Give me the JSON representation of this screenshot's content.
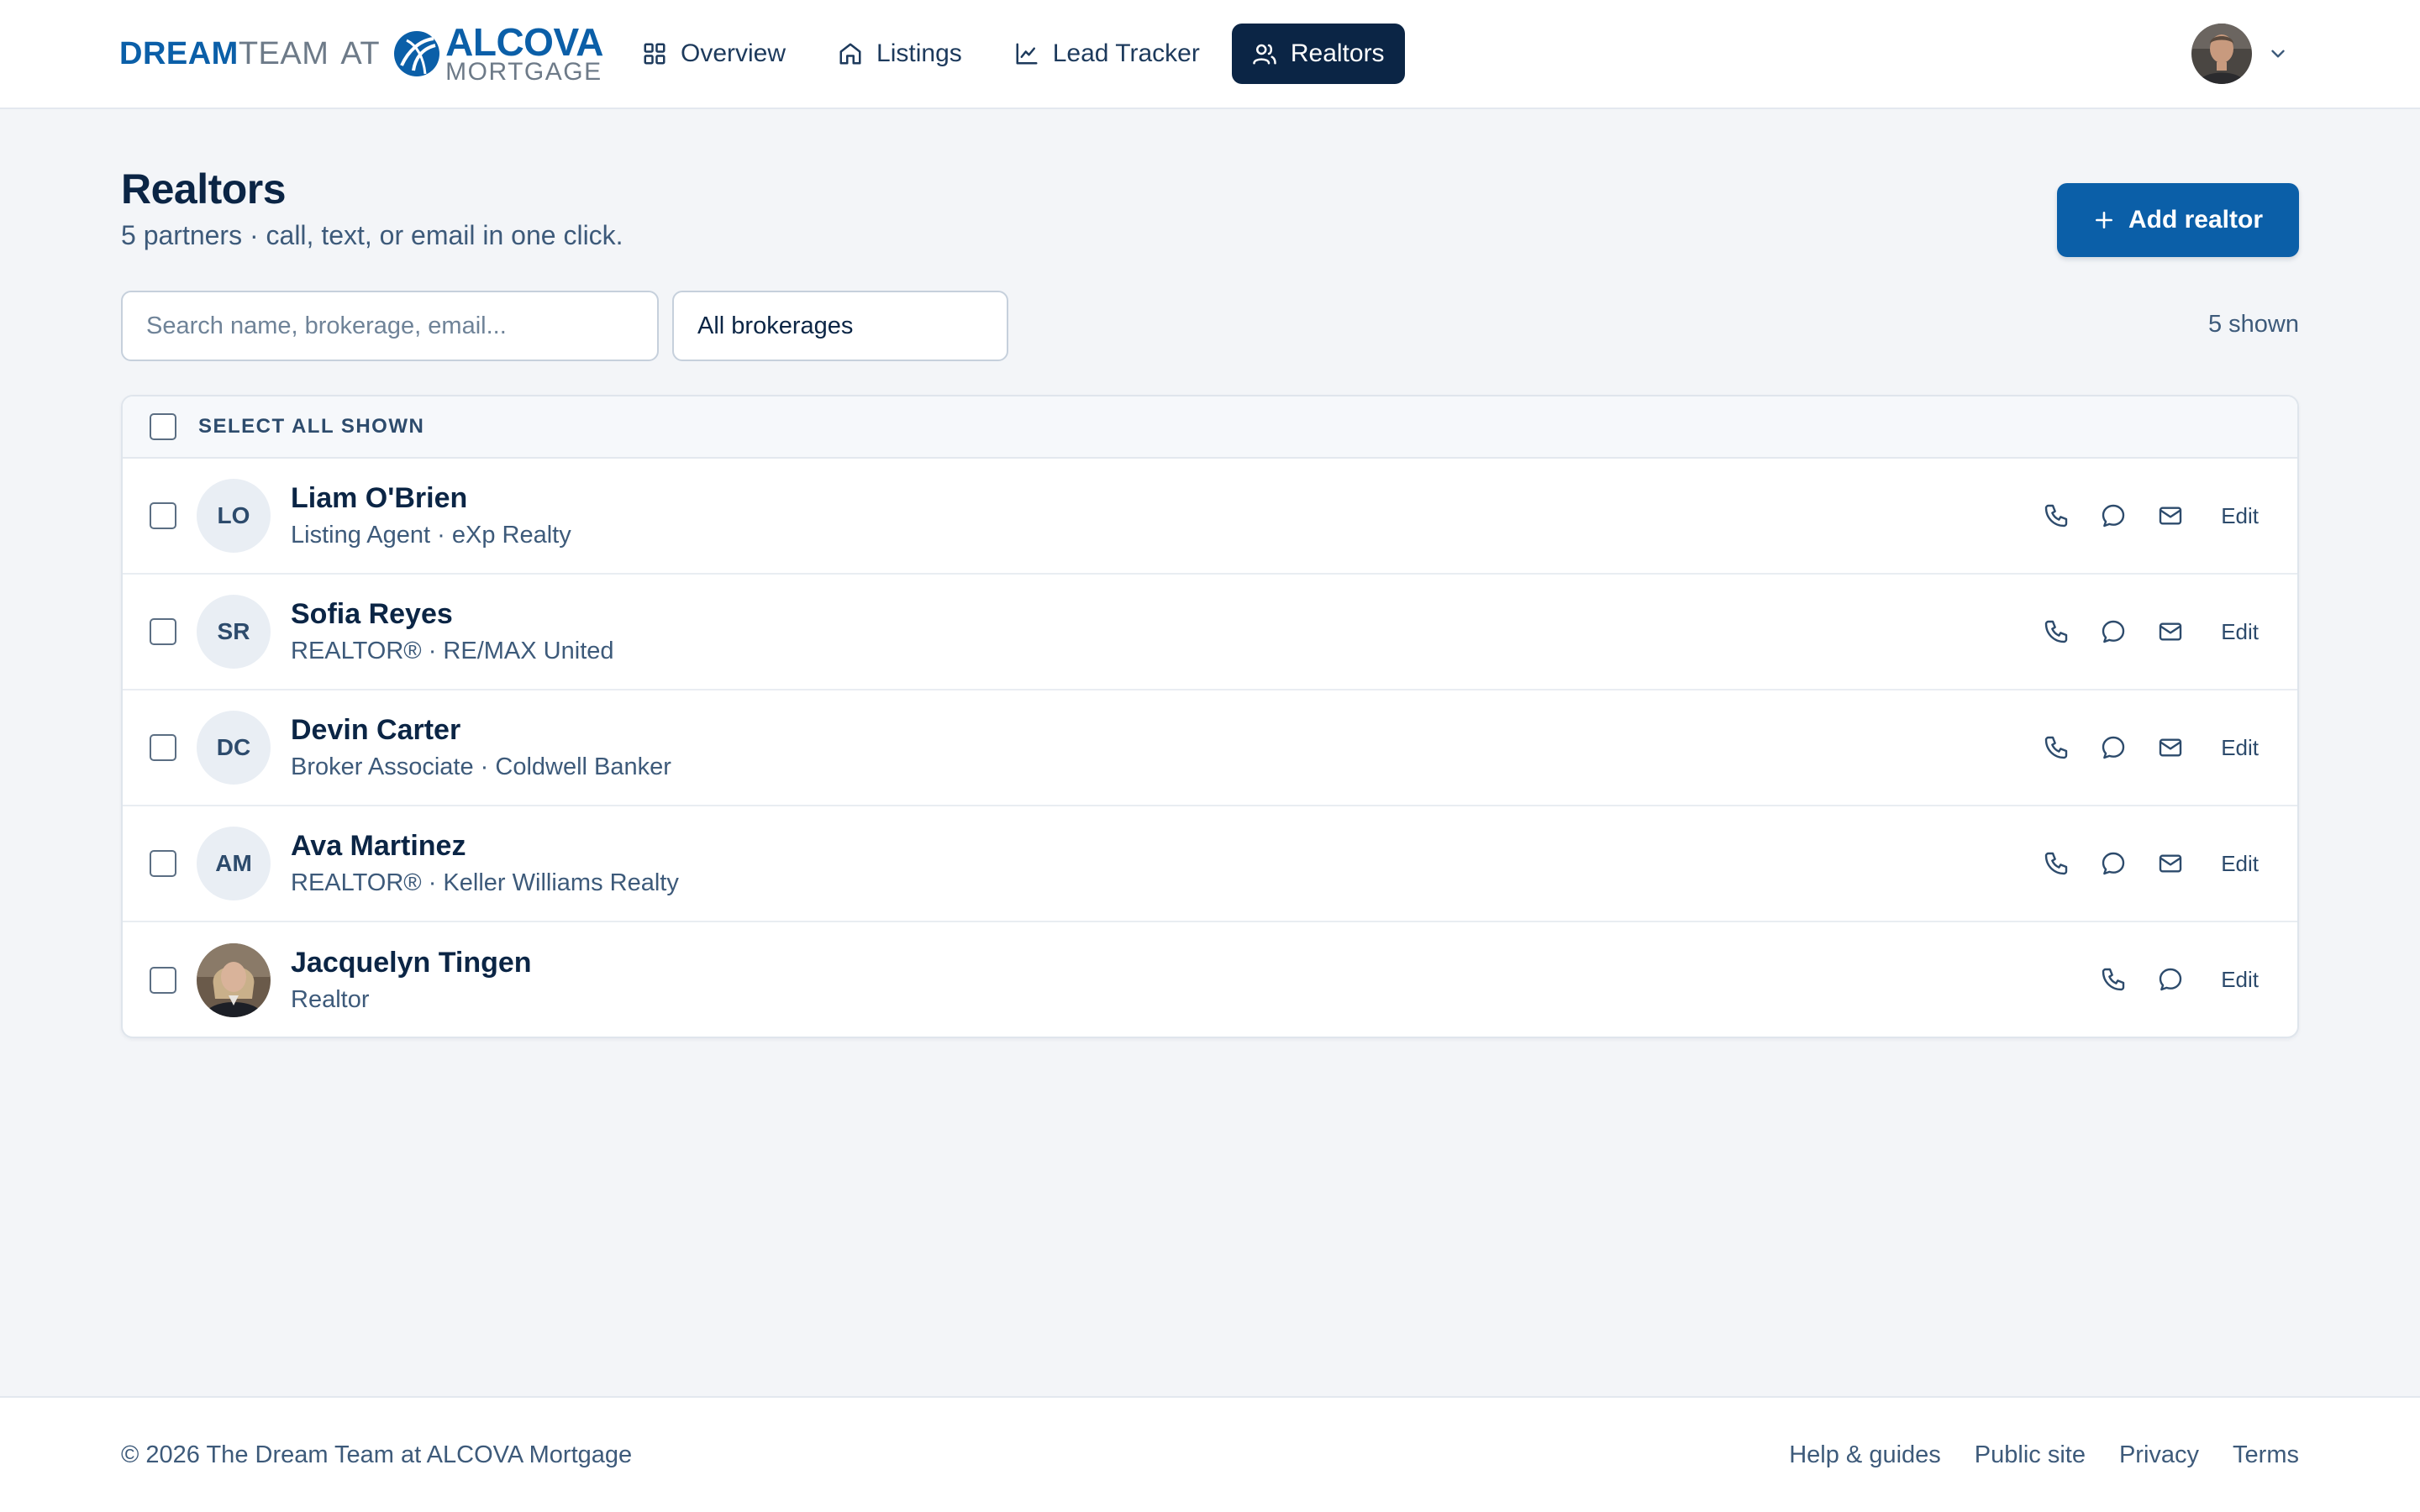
{
  "brand": {
    "dream": "DREAM",
    "team": "TEAM",
    "at": "AT",
    "alcova": "ALCOVA",
    "mortgage": "MORTGAGE",
    "colors": {
      "primary": "#0b5fa8",
      "navy": "#0b2545",
      "grey": "#6d7a88"
    }
  },
  "nav": {
    "items": [
      {
        "label": "Overview",
        "icon": "grid-icon"
      },
      {
        "label": "Listings",
        "icon": "home-icon"
      },
      {
        "label": "Lead Tracker",
        "icon": "line-chart-icon"
      },
      {
        "label": "Realtors",
        "icon": "users-icon",
        "active": true
      }
    ]
  },
  "header": {
    "title": "Realtors",
    "subtitle": "5 partners · call, text, or email in one click.",
    "add_button": "Add realtor"
  },
  "filters": {
    "search_placeholder": "Search name, brokerage, email...",
    "brokerage_selected": "All brokerages",
    "shown_count": "5 shown"
  },
  "table": {
    "select_all_label": "SELECT ALL SHOWN",
    "edit_label": "Edit",
    "rows": [
      {
        "initials": "LO",
        "name": "Liam O'Brien",
        "meta": "Listing Agent · eXp Realty",
        "actions": [
          "phone-icon",
          "message-icon",
          "mail-icon"
        ]
      },
      {
        "initials": "SR",
        "name": "Sofia Reyes",
        "meta": "REALTOR® · RE/MAX United",
        "actions": [
          "phone-icon",
          "message-icon",
          "mail-icon"
        ]
      },
      {
        "initials": "DC",
        "name": "Devin Carter",
        "meta": "Broker Associate · Coldwell Banker",
        "actions": [
          "phone-icon",
          "message-icon",
          "mail-icon"
        ]
      },
      {
        "initials": "AM",
        "name": "Ava Martinez",
        "meta": "REALTOR® · Keller Williams Realty",
        "actions": [
          "phone-icon",
          "message-icon",
          "mail-icon"
        ]
      },
      {
        "initials": "",
        "photo": true,
        "name": "Jacquelyn Tingen",
        "meta": "Realtor",
        "actions": [
          "phone-icon",
          "message-icon"
        ]
      }
    ]
  },
  "footer": {
    "copyright": "© 2026 The Dream Team at ALCOVA Mortgage",
    "links": [
      "Help & guides",
      "Public site",
      "Privacy",
      "Terms"
    ]
  }
}
